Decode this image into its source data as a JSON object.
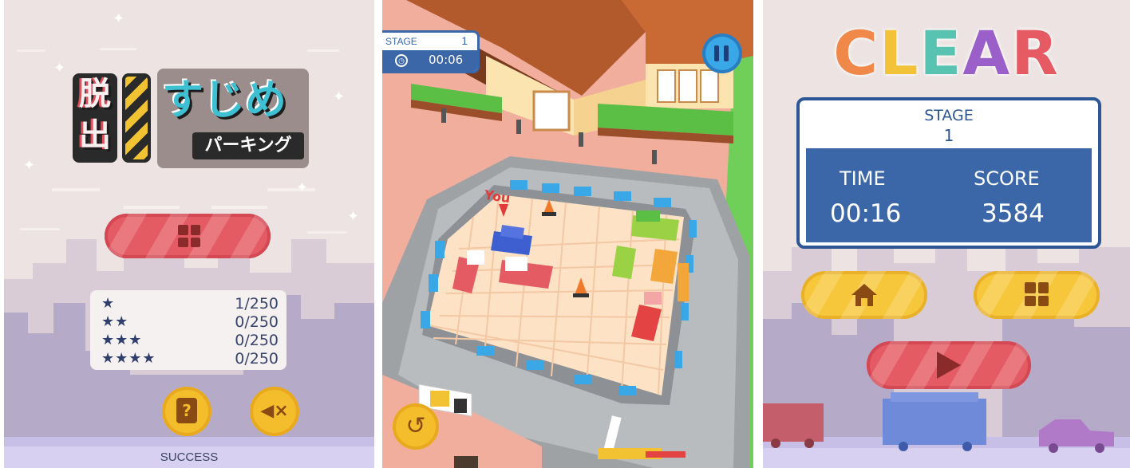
{
  "title_screen": {
    "logo_vertical": [
      "脱",
      "出"
    ],
    "logo_main": "すじめ",
    "logo_sub": "パーキング",
    "play_button_icon": "grid-icon",
    "stats": [
      {
        "stars": "★",
        "value": "1/250"
      },
      {
        "stars": "★★",
        "value": "0/250"
      },
      {
        "stars": "★★★",
        "value": "0/250"
      },
      {
        "stars": "★★★★",
        "value": "0/250"
      }
    ],
    "help_icon": "?",
    "mute_icon": "◀×",
    "footer": "SUCCESS"
  },
  "gameplay_screen": {
    "stage_label": "STAGE",
    "stage_number": "1",
    "timer": "00:06",
    "you_label": "You",
    "pause_icon": "pause-icon",
    "undo_icon": "↺"
  },
  "clear_screen": {
    "title_letters": [
      "C",
      "L",
      "E",
      "A",
      "R"
    ],
    "title_colors": [
      "#f0884a",
      "#f2c238",
      "#58c3b0",
      "#9a5fc9",
      "#e65a64"
    ],
    "stage_label": "STAGE",
    "stage_number": "1",
    "time_label": "TIME",
    "time_value": "00:16",
    "score_label": "SCORE",
    "score_value": "3584"
  },
  "colors": {
    "accent_blue": "#3b67a8",
    "button_red": "#e45b63",
    "button_yellow": "#f7c73b"
  }
}
